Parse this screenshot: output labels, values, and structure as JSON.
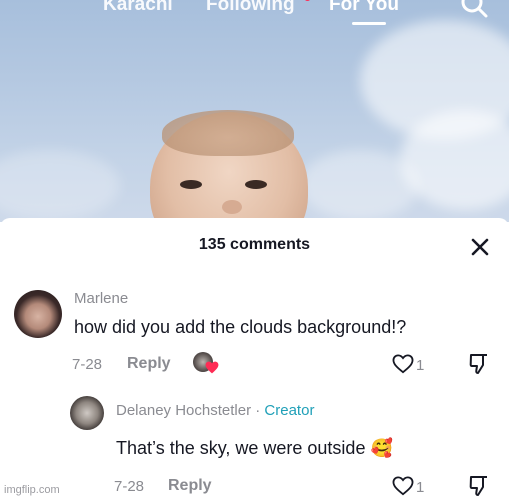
{
  "top_nav": {
    "tabs": [
      {
        "label": "Karachi"
      },
      {
        "label": "Following"
      },
      {
        "label": "For You"
      }
    ],
    "search_icon": "search-icon"
  },
  "sheet": {
    "title": "135 comments",
    "close_icon": "close-icon"
  },
  "comments": [
    {
      "username": "Marlene",
      "text": "how did you add the clouds background!?",
      "date": "7-28",
      "reply_label": "Reply",
      "likes": "1"
    },
    {
      "username": "Delaney Hochstetler",
      "separator": "·",
      "badge": "Creator",
      "text": "That’s the sky, we were outside 🥰",
      "date": "7-28",
      "reply_label": "Reply",
      "likes": "1"
    }
  ],
  "watermark": "imgflip.com",
  "colors": {
    "accent": "#fe2c55",
    "creator": "#20a0b8",
    "text": "#161823",
    "muted": "#8a8b91"
  }
}
